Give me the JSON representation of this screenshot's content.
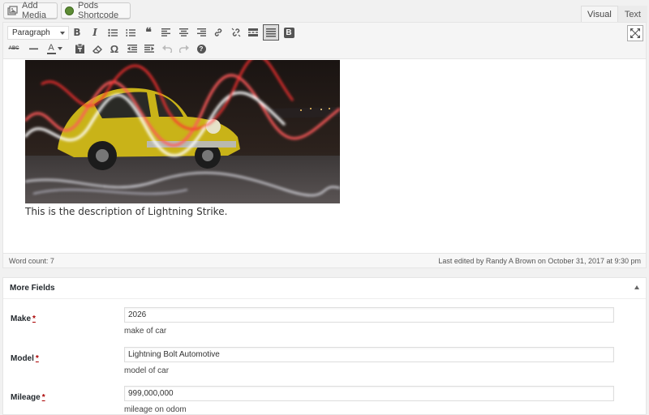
{
  "media_buttons": {
    "add_media": "Add Media",
    "pods_shortcode": "Pods Shortcode"
  },
  "editor_tabs": {
    "visual": "Visual",
    "text": "Text"
  },
  "toolbar": {
    "format_select": "Paragraph",
    "row1_icons": [
      "bold-icon",
      "italic-icon",
      "bullet-list-icon",
      "numbered-list-icon",
      "blockquote-icon",
      "align-left-icon",
      "align-center-icon",
      "align-right-icon",
      "insert-link-icon",
      "remove-link-icon",
      "read-more-icon",
      "toolbar-toggle-icon",
      "pods-b-icon"
    ],
    "row2_icons": [
      "strikethrough-icon",
      "horizontal-line-icon",
      "text-color-icon",
      "paste-text-icon",
      "clear-formatting-icon",
      "special-character-icon",
      "outdent-icon",
      "indent-icon",
      "undo-icon",
      "redo-icon",
      "help-icon"
    ],
    "fullscreen_icon": "fullscreen-icon"
  },
  "content": {
    "description": "This is the description of Lightning Strike."
  },
  "status": {
    "word_count": "Word count: 7",
    "last_edited": "Last edited by Randy A Brown on October 31, 2017 at 9:30 pm"
  },
  "more_fields": {
    "title": "More Fields",
    "required_mark": "*",
    "fields": [
      {
        "label": "Make",
        "value": "2026",
        "help": "make of car"
      },
      {
        "label": "Model",
        "value": "Lightning Bolt Automotive",
        "help": "model of car"
      },
      {
        "label": "Mileage",
        "value": "999,000,000",
        "help": "mileage on odom"
      }
    ]
  },
  "colors": {
    "accent_required": "#aa0000",
    "toolbar_bg": "#f5f5f5",
    "pods_green": "#5d8c35"
  }
}
